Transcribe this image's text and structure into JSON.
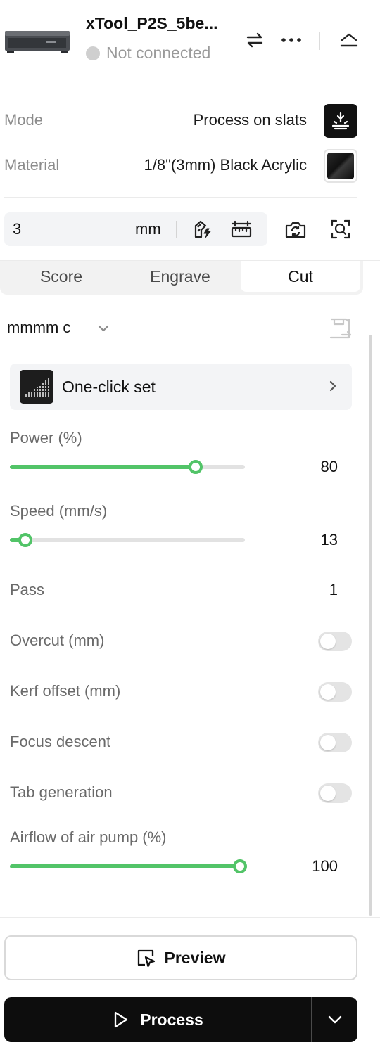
{
  "header": {
    "device_name": "xTool_P2S_5be...",
    "status": "Not connected"
  },
  "mode": {
    "label": "Mode",
    "value": "Process on slats"
  },
  "material": {
    "label": "Material",
    "value": "1/8\"(3mm) Black Acrylic"
  },
  "thickness": {
    "value": "3",
    "unit": "mm"
  },
  "tabs": [
    {
      "label": "Score",
      "active": false
    },
    {
      "label": "Engrave",
      "active": false
    },
    {
      "label": "Cut",
      "active": true
    }
  ],
  "preset": {
    "name": "mmmm c"
  },
  "one_click": {
    "label": "One-click set"
  },
  "params": {
    "power": {
      "label": "Power (%)",
      "value": "80",
      "fraction": 0.79
    },
    "speed": {
      "label": "Speed (mm/s)",
      "value": "13",
      "fraction": 0.066
    },
    "pass": {
      "label": "Pass",
      "value": "1"
    },
    "overcut": {
      "label": "Overcut (mm)",
      "enabled": false
    },
    "kerf": {
      "label": "Kerf offset (mm)",
      "enabled": false
    },
    "focus": {
      "label": "Focus descent",
      "enabled": false
    },
    "tab_gen": {
      "label": "Tab generation",
      "enabled": false
    },
    "airflow": {
      "label": "Airflow of air pump (%)",
      "value": "100",
      "fraction": 0.98
    }
  },
  "actions": {
    "preview": "Preview",
    "process": "Process"
  },
  "colors": {
    "accent": "#52c468",
    "status_dot": "#cfcfcf",
    "process_bg": "#0d0d0d"
  },
  "icons": [
    "swap-icon",
    "more-icon",
    "collapse-icon",
    "laser-mode-icon",
    "material-swatch",
    "material-test-icon",
    "measure-icon",
    "camera-refresh-icon",
    "scan-icon",
    "chevron-down-icon",
    "save-export-icon",
    "chevron-right-icon",
    "preview-icon",
    "play-icon"
  ]
}
